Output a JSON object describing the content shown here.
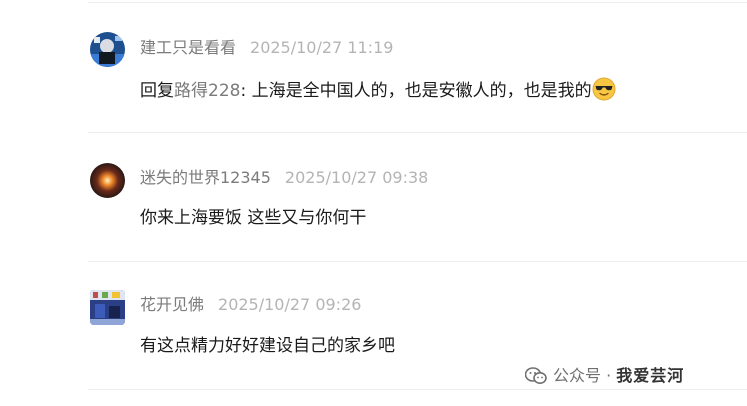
{
  "comments": [
    {
      "username": "建工只是看看",
      "time": "2025/10/27 11:19",
      "reply_prefix": "回复",
      "reply_to": "路得228",
      "text": ": 上海是全中国人的，也是安徽人的，也是我的",
      "emoji": "sunglasses-emoji"
    },
    {
      "username": "迷失的世界12345",
      "time": "2025/10/27 09:38",
      "text": "你来上海要饭 这些又与你何干"
    },
    {
      "username": "花开见佛",
      "time": "2025/10/27 09:26",
      "text": "有这点精力好好建设自己的家乡吧"
    }
  ],
  "watermark": {
    "channel": "公众号 · ",
    "handle": "我爱芸河"
  }
}
